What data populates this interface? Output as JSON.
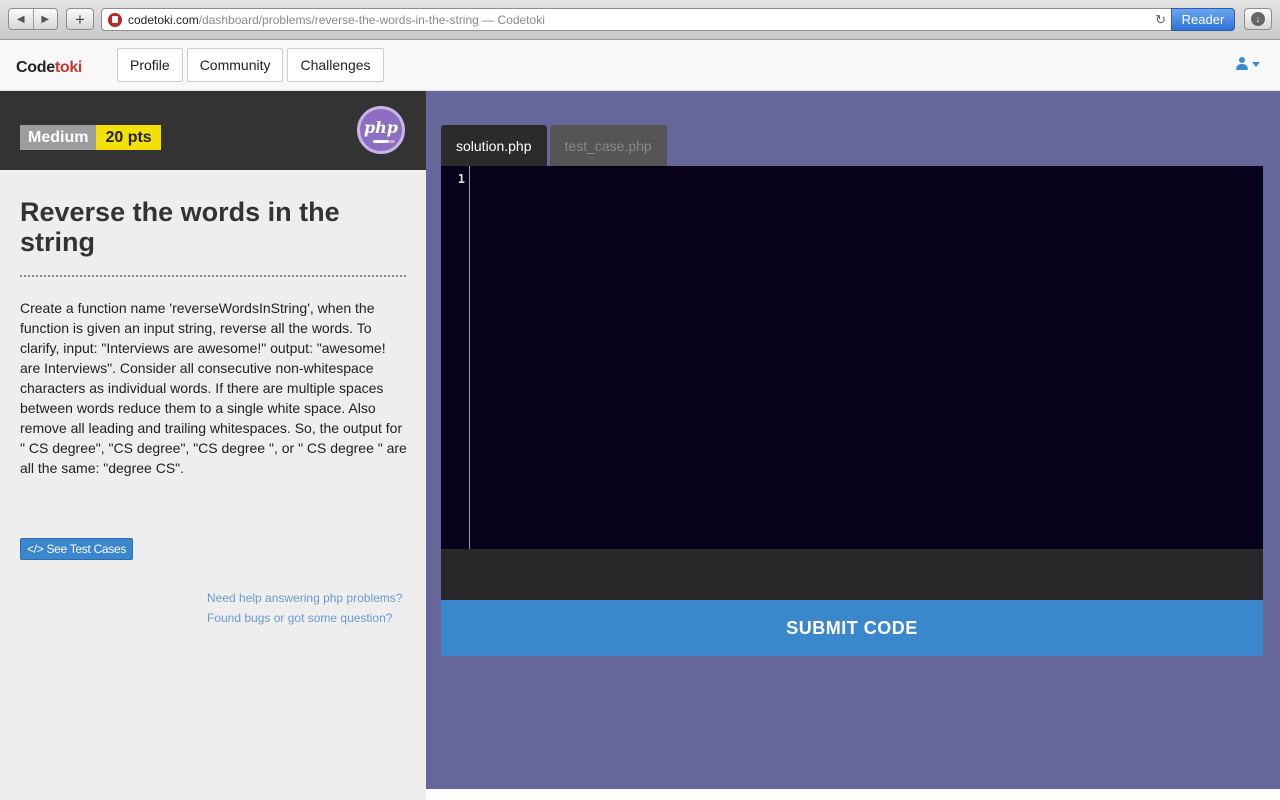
{
  "browser": {
    "url_host": "codetoki.com",
    "url_path": "/dashboard/problems/reverse-the-words-in-the-string",
    "url_title": " — Codetoki",
    "reader_label": "Reader"
  },
  "site": {
    "logo_part1": "Code",
    "logo_part2": "toki",
    "nav": {
      "profile": "Profile",
      "community": "Community",
      "challenges": "Challenges"
    }
  },
  "problem": {
    "difficulty": "Medium",
    "points": "20 pts",
    "language_badge": "php",
    "title": "Reverse the words in the string",
    "description": "Create a function name 'reverseWordsInString', when the function is given an input string, reverse all the words. To clarify, input: \"Interviews are awesome!\" output: \"awesome! are Interviews\". Consider all consecutive non-whitespace characters as individual words. If there are multiple spaces between words reduce them to a single white space. Also remove all leading and trailing whitespaces. So, the output for \" CS degree\", \"CS degree\", \"CS degree \", or \" CS degree \" are all the same: \"degree CS\".",
    "test_cases_button": "See Test Cases",
    "help_link": "Need help answering php problems?",
    "bug_link": "Found bugs or got some question?"
  },
  "editor": {
    "tabs": [
      {
        "label": "solution.php",
        "active": true
      },
      {
        "label": "test_case.php",
        "active": false
      }
    ],
    "line_number": "1",
    "submit_label": "SUBMIT CODE"
  },
  "colors": {
    "editor_bg": "#07011a",
    "panel_bg": "#65679b",
    "submit_bg": "#3b87cb",
    "points_bg": "#f3e00a",
    "logo_accent": "#c23a33"
  }
}
